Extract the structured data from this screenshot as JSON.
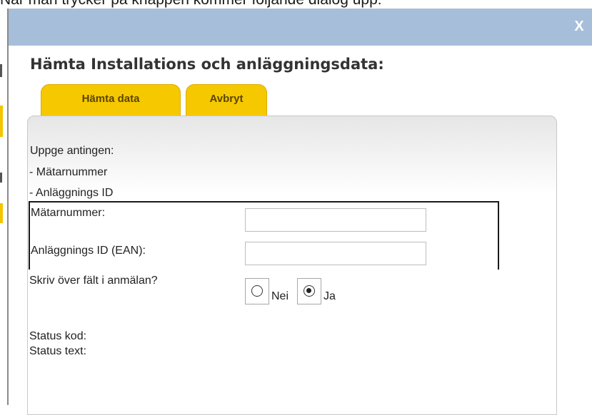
{
  "doc_caption": "När man trycker på knappen kommer följande dialog upp:",
  "dialog": {
    "close_label": "X",
    "heading": "Hämta Installations och anläggningsdata:",
    "tabs": [
      {
        "label": "Hämta data"
      },
      {
        "label": "Avbryt"
      }
    ],
    "instructions": {
      "title": "Uppge antingen:",
      "items": [
        "- Mätarnummer",
        "- Anläggnings ID"
      ]
    },
    "fields": {
      "meter_number": {
        "label": "Mätarnummer:",
        "value": ""
      },
      "facility_id": {
        "label": "Anläggnings ID (EAN):",
        "value": ""
      }
    },
    "overwrite": {
      "question": "Skriv över fält i anmälan?",
      "options": [
        {
          "label": "Nei",
          "selected": false
        },
        {
          "label": "Ja",
          "selected": true
        }
      ]
    },
    "status": {
      "code_label": "Status kod:",
      "text_label": "Status text:"
    }
  },
  "colors": {
    "titlebar": "#a7bedb",
    "tab_fill": "#f6c800",
    "tab_text": "#5a4500"
  }
}
